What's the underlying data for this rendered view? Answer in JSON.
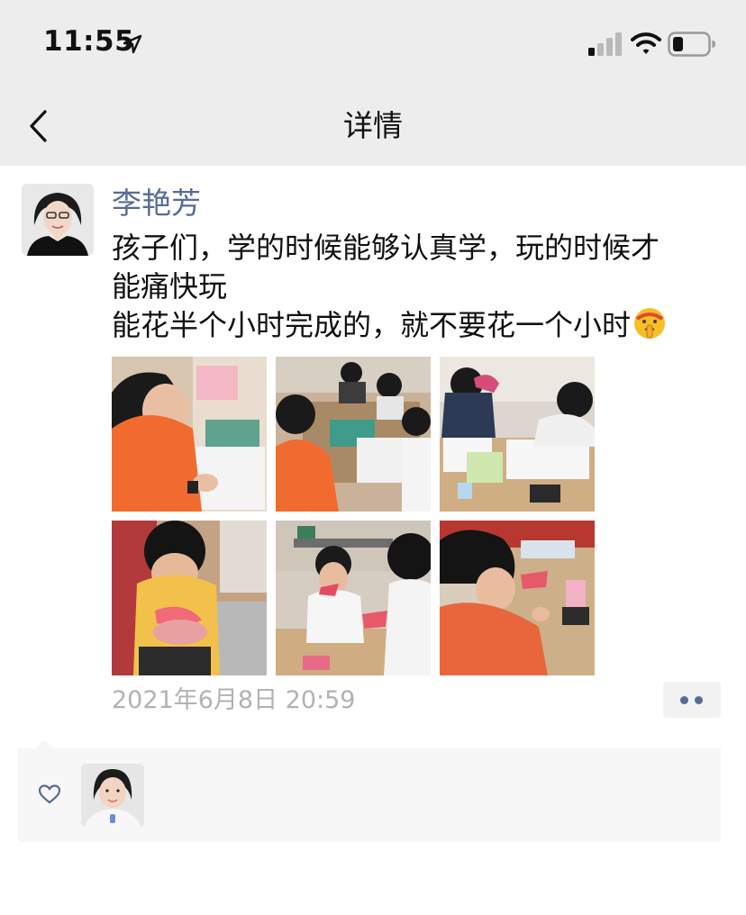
{
  "status_bar": {
    "time": "11:55",
    "icons": [
      "location-arrow-icon",
      "cellular-signal-icon",
      "wifi-icon",
      "battery-icon"
    ]
  },
  "nav": {
    "title": "详情",
    "back_icon": "chevron-left-icon"
  },
  "post": {
    "author": "李艳芳",
    "text_lines": [
      "孩子们，学的时候能够认真学，玩的时候才",
      "能痛快玩",
      "能花半个小时完成的，就不要花一个小时"
    ],
    "trailing_emoji": "shushing-face-emoji",
    "photo_count": 6,
    "timestamp": "2021年6月8日 20:59",
    "more_icon": "more-dots-icon"
  },
  "likes": {
    "icon": "heart-outline-icon",
    "count": 1
  },
  "colors": {
    "nav_background": "#ededed",
    "link_blue": "#576b95",
    "timestamp_gray": "#b2b2b2",
    "likes_background": "#f7f7f7"
  }
}
